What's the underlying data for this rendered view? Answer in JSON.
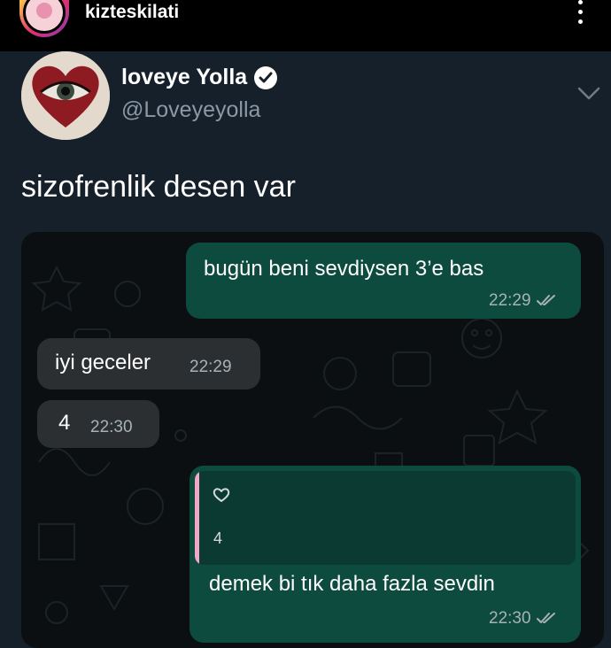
{
  "story": {
    "username": "kizteskilati"
  },
  "tweet": {
    "display_name": "loveye Yolla",
    "handle": "@Loveyeyolla",
    "text": "sizofrenlik desen var"
  },
  "chat": {
    "messages": [
      {
        "direction": "outgoing",
        "text": "bugün beni sevdiysen 3’e bas",
        "time": "22:29",
        "read": true
      },
      {
        "direction": "incoming",
        "text": "iyi geceler",
        "time": "22:29"
      },
      {
        "direction": "incoming",
        "text": "4",
        "time": "22:30"
      },
      {
        "direction": "outgoing",
        "quote_text": "4",
        "text": "demek bi tık daha fazla sevdin",
        "time": "22:30",
        "read": true
      }
    ]
  },
  "icons": {
    "story_menu": "more-vertical-icon",
    "verified": "verified-badge-icon",
    "tweet_menu": "chevron-down-icon",
    "read_receipt": "double-check-icon",
    "quote": "heart-outline-icon"
  },
  "colors": {
    "background": "#15202b",
    "outgoing_bubble": "#0d4b3e",
    "incoming_bubble": "#2b2f31",
    "quote_accent": "#f1a7c6",
    "secondary_text": "#8b98a5"
  }
}
